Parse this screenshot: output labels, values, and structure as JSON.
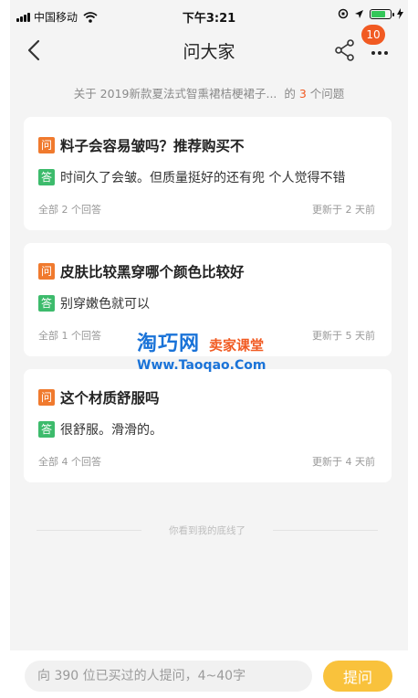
{
  "status_bar": {
    "carrier": "中国移动",
    "time": "下午3:21",
    "battery_level": 0.75
  },
  "nav": {
    "title": "问大家",
    "badge_count": "10"
  },
  "summary": {
    "prefix": "关于 2019新款夏法式智熏裙桔梗裙子...",
    "mid": "的",
    "count": "3",
    "suffix": "个问题"
  },
  "tags": {
    "question": "问",
    "answer": "答"
  },
  "questions": [
    {
      "question": "料子会容易皱吗？推荐购买不",
      "answer": "时间久了会皱。但质量挺好的还有兜 个人觉得不错",
      "answers_count": "全部 2 个回答",
      "updated": "更新于 2 天前"
    },
    {
      "question": "皮肤比较黑穿哪个颜色比较好",
      "answer": "别穿嫩色就可以",
      "answers_count": "全部 1 个回答",
      "updated": "更新于 5 天前"
    },
    {
      "question": "这个材质舒服吗",
      "answer": "很舒服。滑滑的。",
      "answers_count": "全部 4 个回答",
      "updated": "更新于 4 天前"
    }
  ],
  "watermark": {
    "brand": "淘巧网",
    "sub": "卖家课堂",
    "url": "Www.Taoqao.Com"
  },
  "end_text": "你看到我的底线了",
  "bottom": {
    "input_placeholder": "向 390 位已买过的人提问，4~40字",
    "ask_button": "提问"
  },
  "colors": {
    "accent_orange": "#f15a22",
    "question_tag": "#f07a2e",
    "answer_tag": "#3dbb6c",
    "ask_button": "#f9c23c",
    "watermark_blue": "#1a73d8"
  }
}
